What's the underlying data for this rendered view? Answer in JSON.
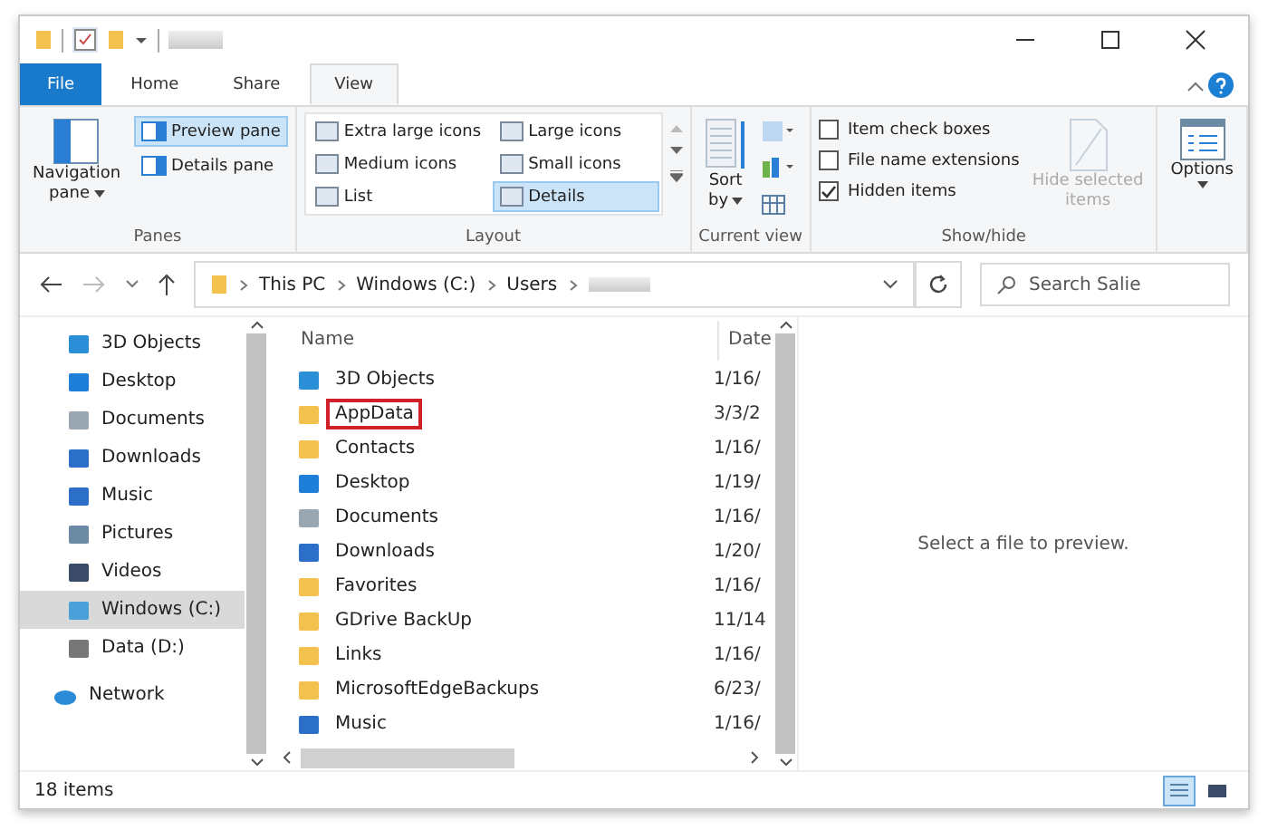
{
  "ribbon_tabs": [
    {
      "label": "File",
      "kind": "file",
      "selected": false
    },
    {
      "label": "Home",
      "kind": "tab",
      "selected": false
    },
    {
      "label": "Share",
      "kind": "tab",
      "selected": false
    },
    {
      "label": "View",
      "kind": "tab",
      "selected": true
    }
  ],
  "panes": {
    "navigation": {
      "label": "Navigation",
      "label2": "pane"
    },
    "items": [
      {
        "label": "Preview pane",
        "selected": true
      },
      {
        "label": "Details pane",
        "selected": false
      }
    ],
    "group": "Panes"
  },
  "layout": {
    "items": [
      {
        "label": "Extra large icons",
        "selected": false
      },
      {
        "label": "Large icons",
        "selected": false
      },
      {
        "label": "Medium icons",
        "selected": false
      },
      {
        "label": "Small icons",
        "selected": false
      },
      {
        "label": "List",
        "selected": false
      },
      {
        "label": "Details",
        "selected": true
      }
    ],
    "group": "Layout"
  },
  "current_view": {
    "sort_label": "Sort",
    "sort_label2": "by",
    "group": "Current view"
  },
  "show_hide": {
    "checks": [
      {
        "label": "Item check boxes",
        "checked": false
      },
      {
        "label": "File name extensions",
        "checked": false
      },
      {
        "label": "Hidden items",
        "checked": true
      }
    ],
    "hide_selected": {
      "label": "Hide selected",
      "label2": "items",
      "disabled": true
    },
    "options": "Options",
    "group": "Show/hide"
  },
  "address": {
    "crumbs": [
      "This PC",
      "Windows (C:)",
      "Users"
    ],
    "search_placeholder": "Search Salie"
  },
  "sidebar": {
    "items": [
      {
        "label": "3D Objects",
        "kind": "cube",
        "selected": false
      },
      {
        "label": "Desktop",
        "kind": "desktop",
        "selected": false
      },
      {
        "label": "Documents",
        "kind": "doc",
        "selected": false
      },
      {
        "label": "Downloads",
        "kind": "download",
        "selected": false
      },
      {
        "label": "Music",
        "kind": "music",
        "selected": false
      },
      {
        "label": "Pictures",
        "kind": "picture",
        "selected": false
      },
      {
        "label": "Videos",
        "kind": "video",
        "selected": false
      },
      {
        "label": "Windows (C:)",
        "kind": "drive",
        "selected": true
      },
      {
        "label": "Data (D:)",
        "kind": "disk",
        "selected": false
      }
    ],
    "network": "Network"
  },
  "files": {
    "columns": [
      "Name",
      "Date"
    ],
    "rows": [
      {
        "name": "3D Objects",
        "date": "1/16/",
        "kind": "cube",
        "highlighted": false
      },
      {
        "name": "AppData",
        "date": "3/3/2",
        "kind": "folder",
        "highlighted": true
      },
      {
        "name": "Contacts",
        "date": "1/16/",
        "kind": "folder",
        "highlighted": false
      },
      {
        "name": "Desktop",
        "date": "1/19/",
        "kind": "desktop",
        "highlighted": false
      },
      {
        "name": "Documents",
        "date": "1/16/",
        "kind": "doc",
        "highlighted": false
      },
      {
        "name": "Downloads",
        "date": "1/20/",
        "kind": "download",
        "highlighted": false
      },
      {
        "name": "Favorites",
        "date": "1/16/",
        "kind": "folder",
        "highlighted": false
      },
      {
        "name": "GDrive BackUp",
        "date": "11/14",
        "kind": "folder",
        "highlighted": false
      },
      {
        "name": "Links",
        "date": "1/16/",
        "kind": "folder",
        "highlighted": false
      },
      {
        "name": "MicrosoftEdgeBackups",
        "date": "6/23/",
        "kind": "folder",
        "highlighted": false
      },
      {
        "name": "Music",
        "date": "1/16/",
        "kind": "music",
        "highlighted": false
      }
    ]
  },
  "preview": {
    "message": "Select a file to preview."
  },
  "status_bar": {
    "count": "18 items",
    "view_buttons": [
      {
        "kind": "details",
        "selected": true
      },
      {
        "kind": "icons",
        "selected": false
      }
    ]
  }
}
